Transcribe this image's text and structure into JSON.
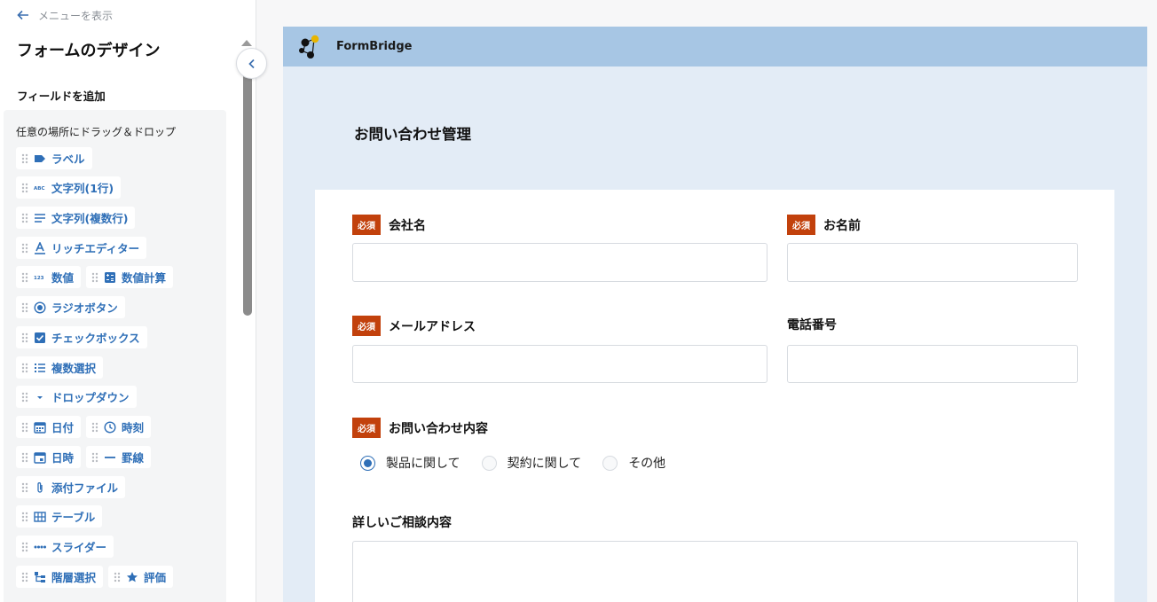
{
  "sidebar": {
    "back_label": "メニューを表示",
    "title": "フォームのデザイン",
    "section_title": "フィールドを追加",
    "hint": "任意の場所にドラッグ＆ドロップ",
    "items": [
      {
        "label": "ラベル",
        "icon": "label-icon"
      },
      {
        "label": "文字列(1行)",
        "icon": "abc-icon"
      },
      {
        "label": "文字列(複数行)",
        "icon": "lines-icon"
      },
      {
        "label": "リッチエディター",
        "icon": "text-format-icon"
      },
      {
        "label": "数値",
        "icon": "123-icon"
      },
      {
        "label": "数値計算",
        "icon": "calculator-icon"
      },
      {
        "label": "ラジオボタン",
        "icon": "radio-icon"
      },
      {
        "label": "チェックボックス",
        "icon": "checkbox-icon"
      },
      {
        "label": "複数選択",
        "icon": "list-icon"
      },
      {
        "label": "ドロップダウン",
        "icon": "dropdown-icon"
      },
      {
        "label": "日付",
        "icon": "calendar-icon"
      },
      {
        "label": "時刻",
        "icon": "clock-icon"
      },
      {
        "label": "日時",
        "icon": "calendar-time-icon"
      },
      {
        "label": "罫線",
        "icon": "divider-icon"
      },
      {
        "label": "添付ファイル",
        "icon": "paperclip-icon"
      },
      {
        "label": "テーブル",
        "icon": "table-icon"
      },
      {
        "label": "スライダー",
        "icon": "slider-icon"
      },
      {
        "label": "階層選択",
        "icon": "hierarchy-icon"
      },
      {
        "label": "評価",
        "icon": "star-icon"
      }
    ]
  },
  "preview": {
    "brand": "FormBridge",
    "form_title": "お問い合わせ管理",
    "required_badge": "必須",
    "fields": {
      "company": "会社名",
      "name": "お名前",
      "email": "メールアドレス",
      "phone": "電話番号",
      "inquiry": "お問い合わせ内容",
      "details": "詳しいご相談内容"
    },
    "inquiry_options": [
      "製品に関して",
      "契約に関して",
      "その他"
    ],
    "inquiry_selected": "製品に関して"
  },
  "colors": {
    "accent": "#2f6fb7",
    "required": "#c2410c",
    "brand_bar": "#a7c6e4",
    "preview_bg": "#e3ecf6"
  }
}
